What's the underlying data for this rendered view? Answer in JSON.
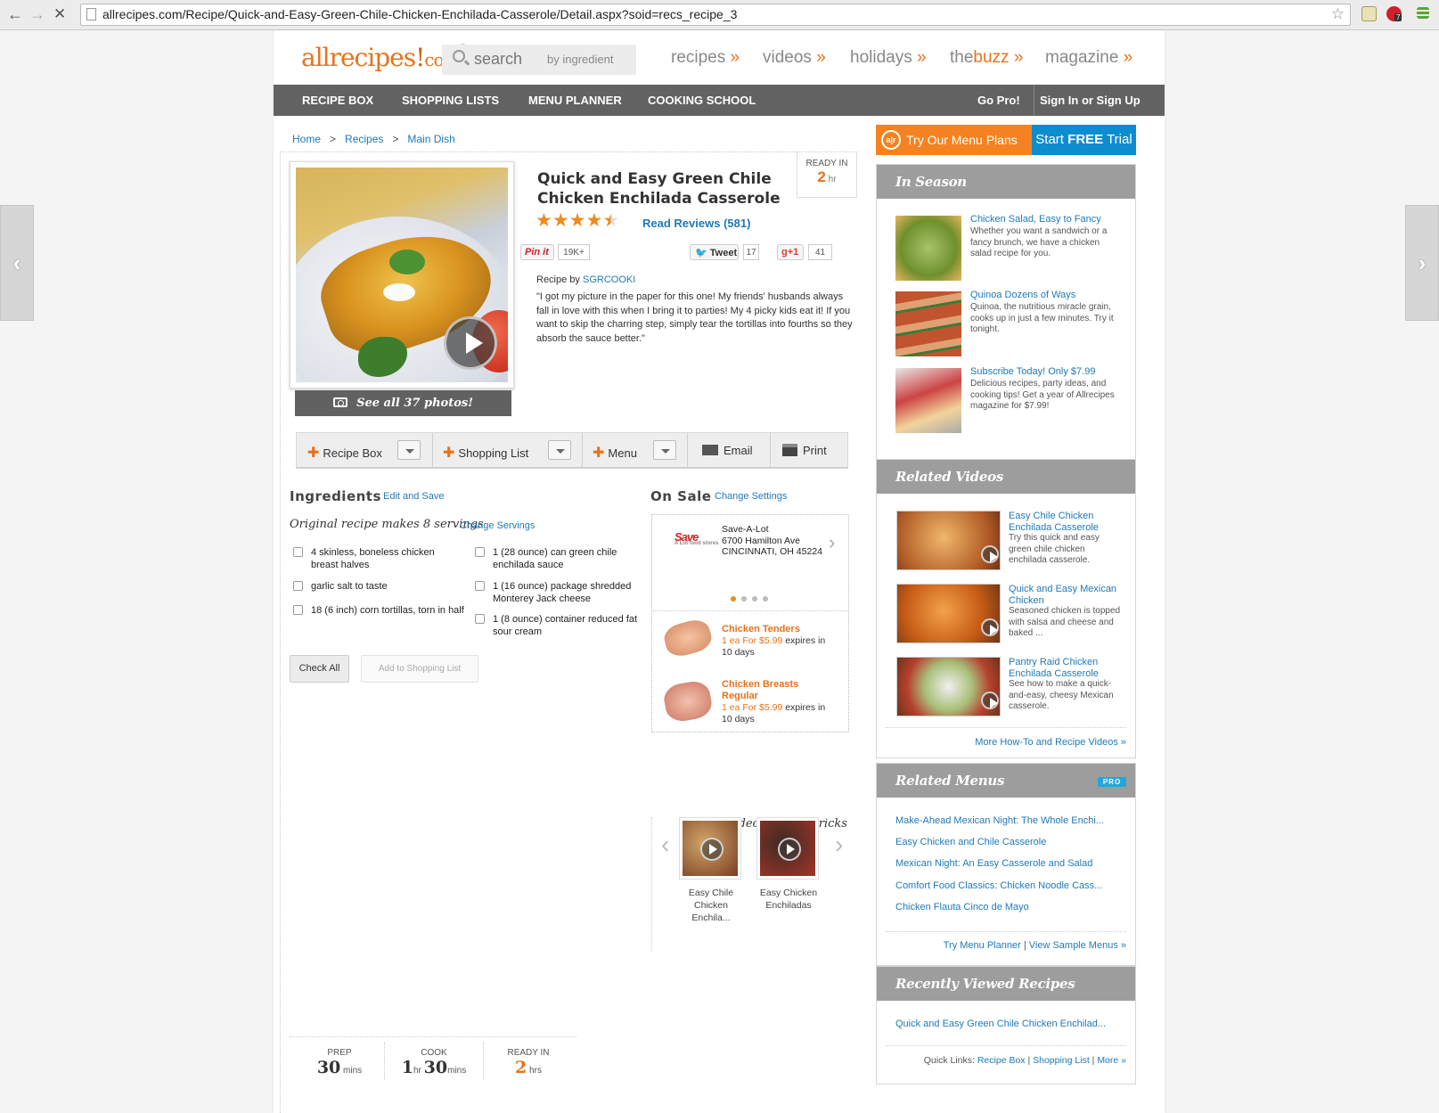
{
  "browser": {
    "url": "allrecipes.com/Recipe/Quick-and-Easy-Green-Chile-Chicken-Enchilada-Casserole/Detail.aspx?soid=recs_recipe_3",
    "ext_badge": "7"
  },
  "header": {
    "logo": "allrecipes",
    "logo_com": "com",
    "search_placeholder": "search",
    "search_by": "by ingredient",
    "nav": [
      {
        "label": "recipes",
        "arrow": "»"
      },
      {
        "label": "videos",
        "arrow": "»"
      },
      {
        "label": "holidays",
        "arrow": "»"
      },
      {
        "label_pre": "the",
        "label_bold": "buzz",
        "arrow": "»"
      },
      {
        "label": "magazine",
        "arrow": "»"
      }
    ],
    "menubar": [
      "RECIPE BOX",
      "SHOPPING LISTS",
      "MENU PLANNER",
      "COOKING SCHOOL"
    ],
    "go_pro": "Go Pro!",
    "sign_in": "Sign In or Sign Up"
  },
  "breadcrumb": [
    "Home",
    "Recipes",
    "Main Dish"
  ],
  "recipe": {
    "title_line1": "Quick and Easy Green Chile",
    "title_line2": "Chicken Enchilada Casserole",
    "ready_label": "READY IN",
    "ready_value": "2",
    "ready_unit": "hr",
    "rating": 4.5,
    "read_reviews": "Read Reviews",
    "review_count": "(581)",
    "see_photos": "See all 37 photos!",
    "pinit": "Pin it",
    "pin_count": "19K+",
    "tweet": "Tweet",
    "tweet_count": "17",
    "gplus": "g+1",
    "gplus_count": "41",
    "recipe_by_label": "Recipe by",
    "author": "SGRCOOKI",
    "quote": "\"I got my picture in the paper for this one! My friends' husbands always fall in love with this when I bring it to parties! My 4 picky kids eat it! If you want to skip the charring step, simply tear the tortillas into fourths so they absorb the sauce better.\""
  },
  "actions": {
    "recipe_box": "Recipe Box",
    "shopping_list": "Shopping List",
    "menu": "Menu",
    "email": "Email",
    "print": "Print"
  },
  "ingredients": {
    "heading": "Ingredients",
    "edit_save": "Edit and Save",
    "servings_text": "Original recipe makes 8 servings",
    "change_servings": "Change Servings",
    "left": [
      "4 skinless, boneless chicken breast halves",
      "garlic salt to taste",
      "18 (6 inch) corn tortillas, torn in half"
    ],
    "right": [
      "1 (28 ounce) can green chile enchilada sauce",
      "1 (16 ounce) package shredded Monterey Jack cheese",
      "1 (8 ounce) container reduced fat sour cream"
    ],
    "check_all": "Check All",
    "add_to_list": "Add to Shopping List"
  },
  "on_sale": {
    "heading": "On Sale",
    "change_settings": "Change Settings",
    "store_logo": "Save",
    "store_logo_sub": "A Lot food stores",
    "store_name": "Save-A-Lot",
    "store_addr": "6700 Hamilton Ave",
    "store_city": "CINCINNATI, OH 45224",
    "items": [
      {
        "name": "Chicken Tenders",
        "price": "1 ea For $5.99",
        "expires": "expires in 10 days"
      },
      {
        "name": "Chicken Breasts Regular",
        "price": "1 ea For $5.99",
        "expires": "expires in 10 days"
      }
    ]
  },
  "video_tips": {
    "heading": "Watch video tips and tricks",
    "items": [
      "Easy Chile Chicken Enchila...",
      "Easy Chicken Enchiladas"
    ]
  },
  "times": {
    "prep_label": "PREP",
    "prep_value": "30",
    "prep_unit": "mins",
    "cook_label": "COOK",
    "cook_hr": "1",
    "cook_hr_unit": "hr",
    "cook_min": "30",
    "cook_min_unit": "mins",
    "ready_label": "READY IN",
    "ready_value": "2",
    "ready_unit": "hrs"
  },
  "sidebar": {
    "menu_plans": "Try Our Menu Plans",
    "menu_plans_logo": "a|r",
    "start_trial_pre": "Start ",
    "start_trial_bold": "FREE",
    "start_trial_post": " Trial",
    "in_season": {
      "heading": "In Season",
      "items": [
        {
          "title": "Chicken Salad, Easy to Fancy",
          "desc": "Whether you want a sandwich or a fancy brunch, we have a chicken salad recipe for you."
        },
        {
          "title": "Quinoa Dozens of Ways",
          "desc": "Quinoa, the nutritious miracle grain, cooks up in just a few minutes. Try it tonight."
        },
        {
          "title": "Subscribe Today! Only $7.99",
          "desc": "Delicious recipes, party ideas, and cooking tips! Get a year of Allrecipes magazine for $7.99!"
        }
      ]
    },
    "related_videos": {
      "heading": "Related Videos",
      "items": [
        {
          "title": "Easy Chile Chicken Enchilada Casserole",
          "desc": "Try this quick and easy green chile chicken enchilada casserole."
        },
        {
          "title": "Quick and Easy Mexican Chicken",
          "desc": "Seasoned chicken is topped with salsa and cheese and baked ..."
        },
        {
          "title": "Pantry Raid Chicken Enchilada Casserole",
          "desc": "See how to make a quick-and-easy, cheesy Mexican casserole."
        }
      ],
      "more": "More How-To and Recipe Videos »"
    },
    "related_menus": {
      "heading": "Related Menus",
      "badge": "PRO",
      "items": [
        "Make-Ahead Mexican Night: The Whole Enchi...",
        "Easy Chicken and Chile Casserole",
        "Mexican Night: An Easy Casserole and Salad",
        "Comfort Food Classics: Chicken Noodle Cass...",
        "Chicken Flauta Cinco de Mayo"
      ],
      "try_planner": "Try Menu Planner",
      "view_sample": "View Sample Menus »"
    },
    "recently_viewed": {
      "heading": "Recently Viewed Recipes",
      "items": [
        "Quick and Easy Green Chile Chicken Enchilad..."
      ],
      "quick_links_label": "Quick Links:",
      "quick_links": [
        "Recipe Box",
        "Shopping List",
        "More »"
      ]
    }
  },
  "colors": {
    "accent": "#e8721a",
    "link": "#1f79b8",
    "menubar": "#626262",
    "trial": "#0e8cd0"
  }
}
